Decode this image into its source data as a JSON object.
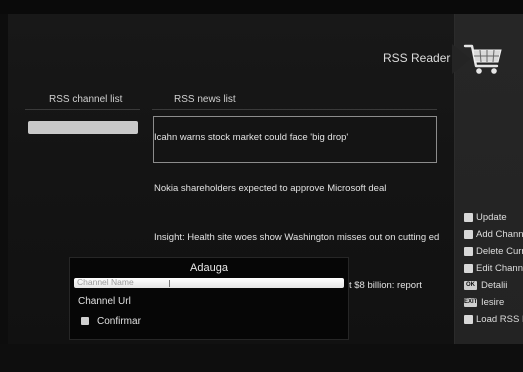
{
  "header": {
    "title": "RSS Reader"
  },
  "columns": {
    "channels": "RSS channel list",
    "news": "RSS news list"
  },
  "channels": [
    {
      "label": ""
    }
  ],
  "news": [
    "Icahn warns stock market could face 'big drop'",
    "Nokia shareholders expected to approve Microsoft deal",
    "Insight: Health site woes show Washington misses out on cutting ed",
    "t $8 billion: report"
  ],
  "menu": [
    {
      "key": "",
      "label": "Update"
    },
    {
      "key": "",
      "label": "Add Channe"
    },
    {
      "key": "",
      "label": "Delete Curr"
    },
    {
      "key": "",
      "label": "Edit Channe"
    },
    {
      "key": "OK",
      "label": "Detalii"
    },
    {
      "key": "EXIT",
      "label": "Iesire"
    },
    {
      "key": "",
      "label": "Load RSS L"
    }
  ],
  "dialog": {
    "title": "Adauga",
    "field_name_label": "Channel Name",
    "field_url_label": "Channel Url",
    "confirm_label": "Confirmar"
  },
  "colors": {
    "background": "#0d0d0d",
    "panel": "#161616",
    "sidebar": "#242424",
    "highlight": "#c9c9c9"
  },
  "icons": {
    "cart": "shopping-cart-icon"
  }
}
